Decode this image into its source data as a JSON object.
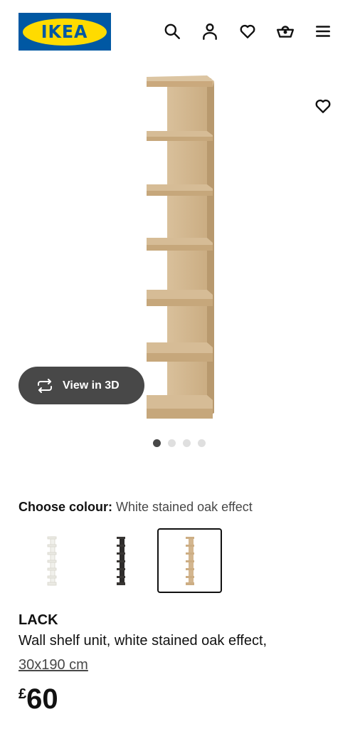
{
  "header": {
    "logo_text": "IKEA",
    "icons": [
      "search-icon",
      "user-icon",
      "heart-icon",
      "basket-icon",
      "menu-icon"
    ]
  },
  "gallery": {
    "view_3d_label": "View in 3D",
    "dot_count": 4,
    "active_dot": 1
  },
  "colour": {
    "label": "Choose colour:",
    "selected_value": "White stained oak effect",
    "swatches": [
      "white",
      "black-brown",
      "white stained oak effect"
    ],
    "selected_index": 2
  },
  "product": {
    "name": "LACK",
    "description": "Wall shelf unit, white stained oak effect,",
    "size": "30x190 cm",
    "currency": "£",
    "price": "60"
  },
  "colors": {
    "brand_blue": "#0058a3",
    "brand_yellow": "#ffdb00",
    "oak": "#d8bf9a",
    "button_dark": "#484848"
  }
}
